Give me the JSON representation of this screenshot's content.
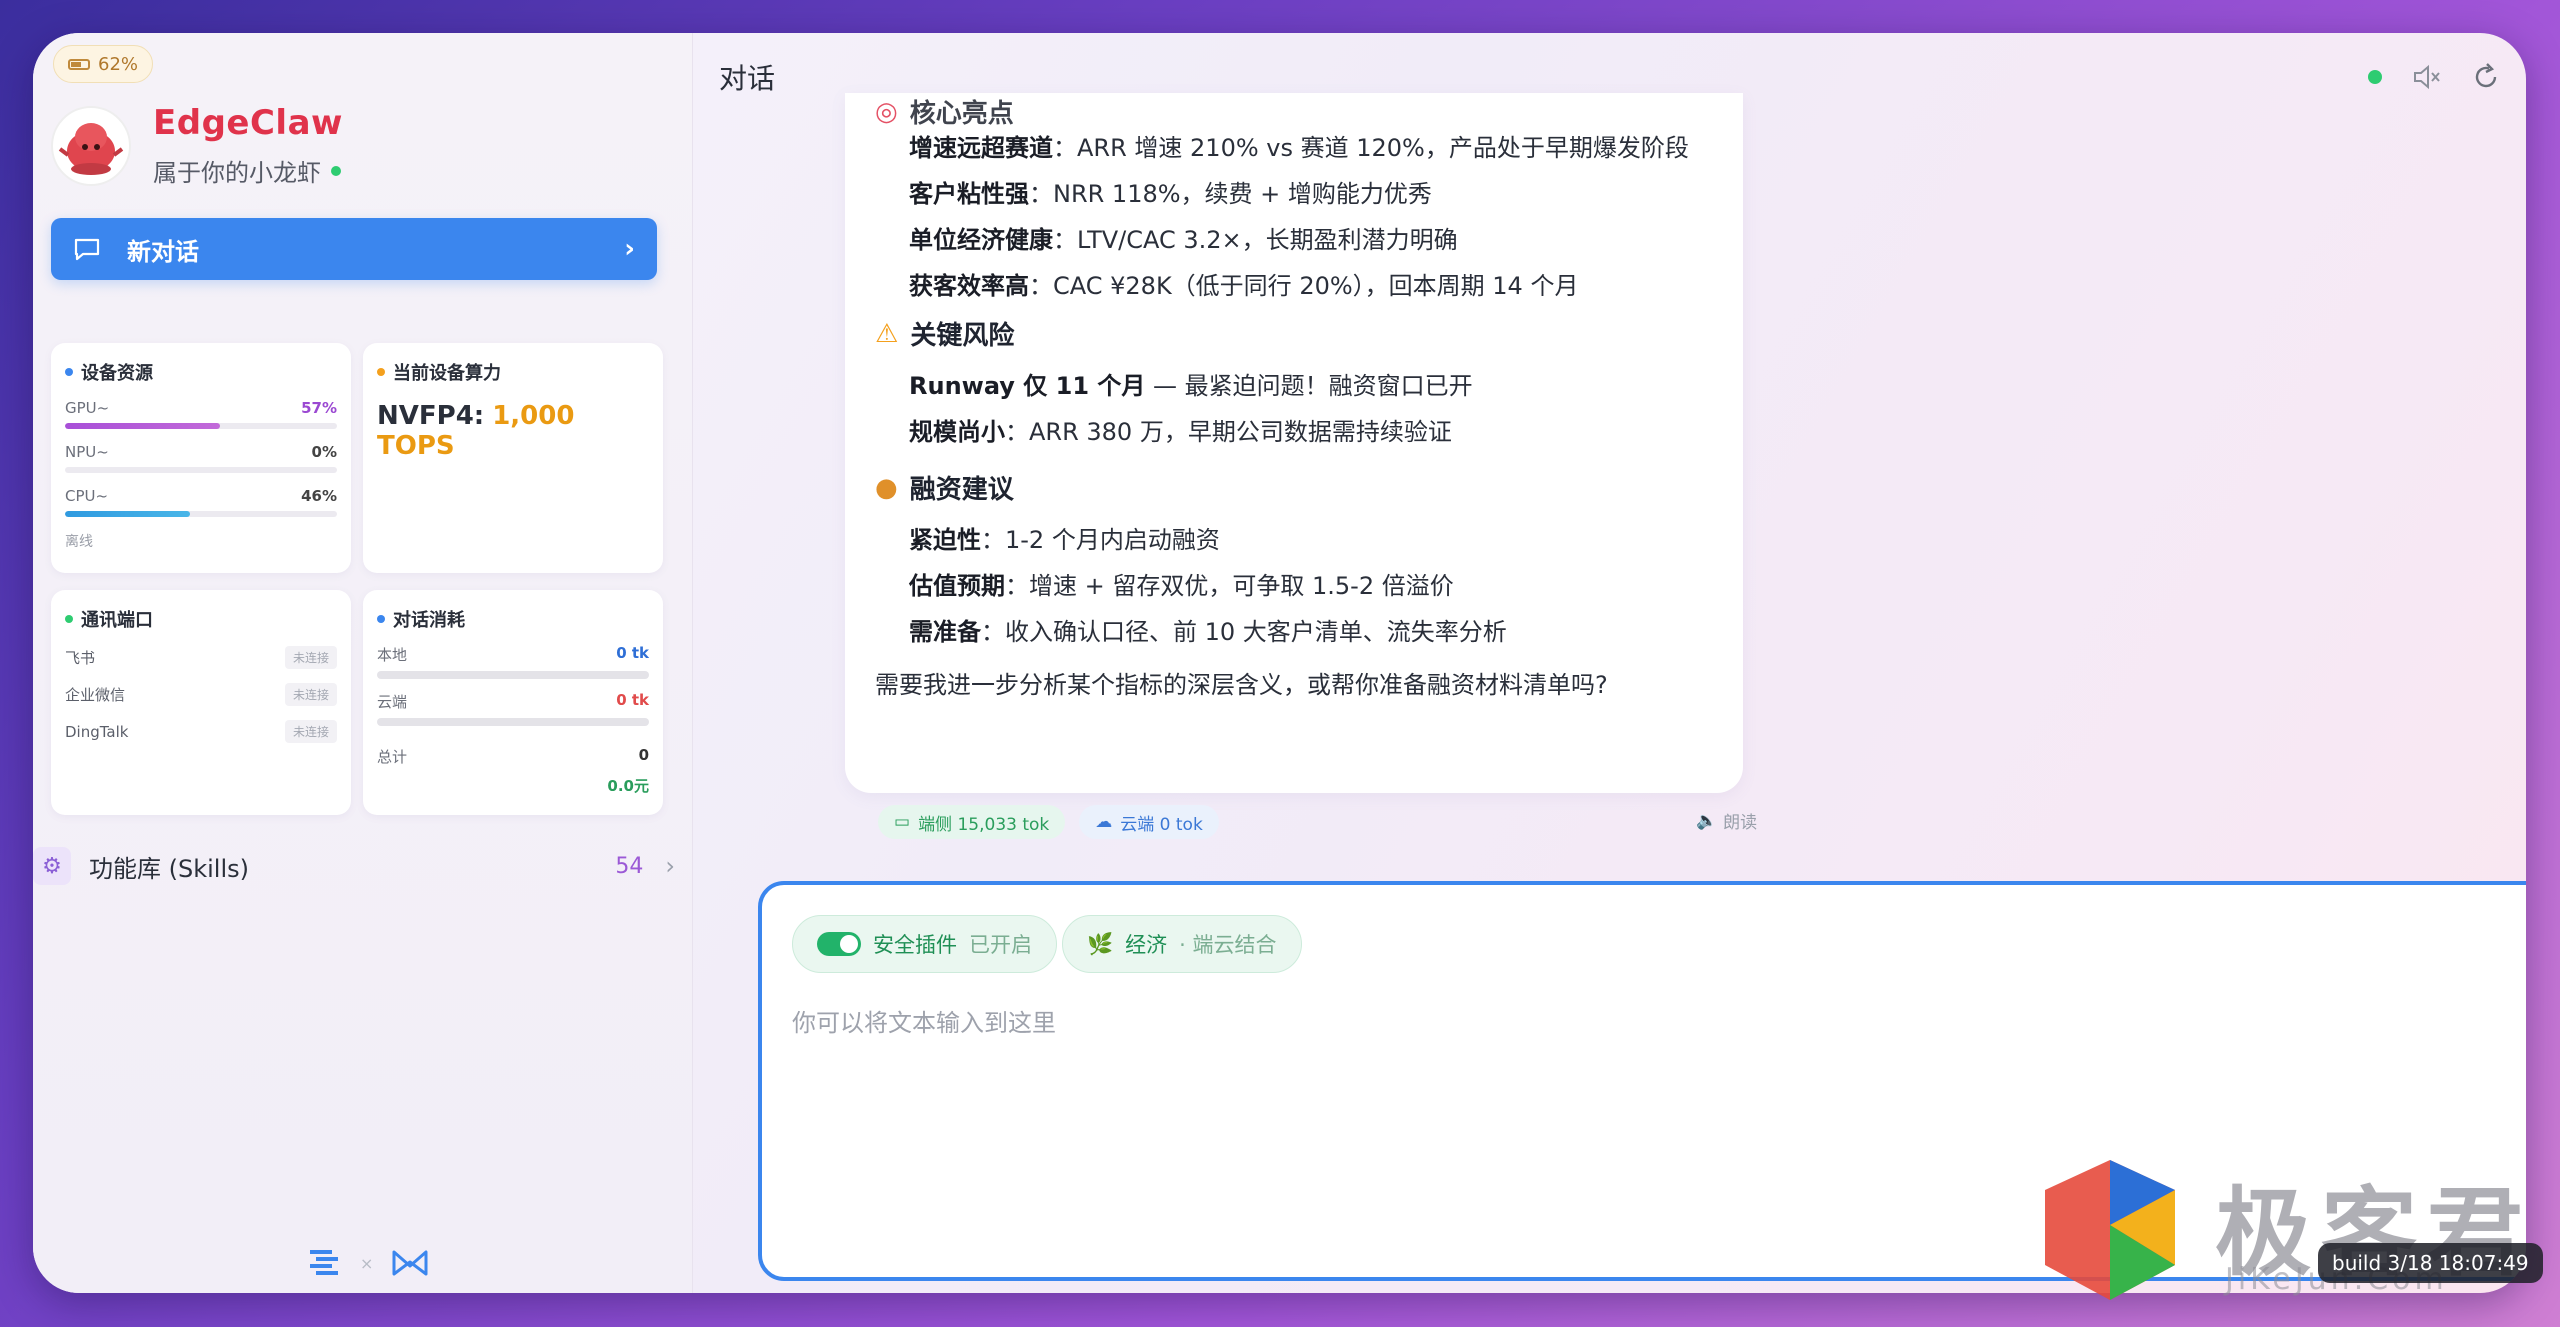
{
  "battery": {
    "label": "62%"
  },
  "profile": {
    "name": "EdgeClaw",
    "subtitle": "属于你的小龙虾"
  },
  "new_chat": {
    "label": "新对话"
  },
  "device_resources": {
    "title": "设备资源",
    "gpu": {
      "label": "GPU~",
      "value": "57%",
      "fraction": 0.57
    },
    "npu": {
      "label": "NPU~",
      "value": "0%",
      "fraction": 0
    },
    "cpu": {
      "label": "CPU~",
      "value": "46%",
      "fraction": 0.46
    },
    "status": "离线"
  },
  "compute": {
    "title": "当前设备算力",
    "label": "NVFP4:",
    "value": "1,000 TOPS"
  },
  "ports": {
    "title": "通讯端口",
    "items": [
      {
        "name": "飞书",
        "status": "未连接"
      },
      {
        "name": "企业微信",
        "status": "未连接"
      },
      {
        "name": "DingTalk",
        "status": "未连接"
      }
    ]
  },
  "tokens": {
    "title": "对话消耗",
    "local": {
      "label": "本地",
      "value": "0 tk"
    },
    "cloud": {
      "label": "云端",
      "value": "0 tk"
    },
    "total": {
      "label": "总计",
      "value": "0"
    },
    "cost": "0.0元"
  },
  "skills": {
    "label": "功能库 (Skills)",
    "count": "54"
  },
  "main": {
    "title": "对话"
  },
  "message": {
    "highlights_title": "核心亮点",
    "highlights": [
      {
        "key": "增速远超赛道",
        "text": "：ARR 增速 210% vs 赛道 120%，产品处于早期爆发阶段"
      },
      {
        "key": "客户粘性强",
        "text": "：NRR 118%，续费 + 增购能力优秀"
      },
      {
        "key": "单位经济健康",
        "text": "：LTV/CAC 3.2×，长期盈利潜力明确"
      },
      {
        "key": "获客效率高",
        "text": "：CAC ¥28K（低于同行 20%），回本周期 14 个月"
      }
    ],
    "risks_title": "关键风险",
    "risks": [
      {
        "key": "Runway 仅 11 个月",
        "text": " — 最紧迫问题！融资窗口已开"
      },
      {
        "key": "规模尚小",
        "text": "：ARR 380 万，早期公司数据需持续验证"
      }
    ],
    "advice_title": "融资建议",
    "advice": [
      {
        "key": "紧迫性",
        "text": "：1-2 个月内启动融资"
      },
      {
        "key": "估值预期",
        "text": "：增速 + 留存双优，可争取 1.5-2 倍溢价"
      },
      {
        "key": "需准备",
        "text": "：收入确认口径、前 10 大客户清单、流失率分析"
      }
    ],
    "followup": "需要我进一步分析某个指标的深层含义，或帮你准备融资材料清单吗?",
    "local_tokens": "端侧 15,033 tok",
    "cloud_tokens": "云端 0 tok",
    "read_label": "朗读"
  },
  "composer": {
    "security_label": "安全插件",
    "security_state": "已开启",
    "mode_label": "经济",
    "mode_detail": "· 端云结合",
    "placeholder": "你可以将文本输入到这里"
  },
  "watermark": {
    "text": "极客君",
    "sub": "JiKeJun.Com"
  },
  "build": "build 3/18 18:07:49",
  "colors": {
    "accent": "#3b86ee",
    "brand": "#e0334b",
    "tops": "#ea9a12",
    "success": "#22b36a"
  }
}
